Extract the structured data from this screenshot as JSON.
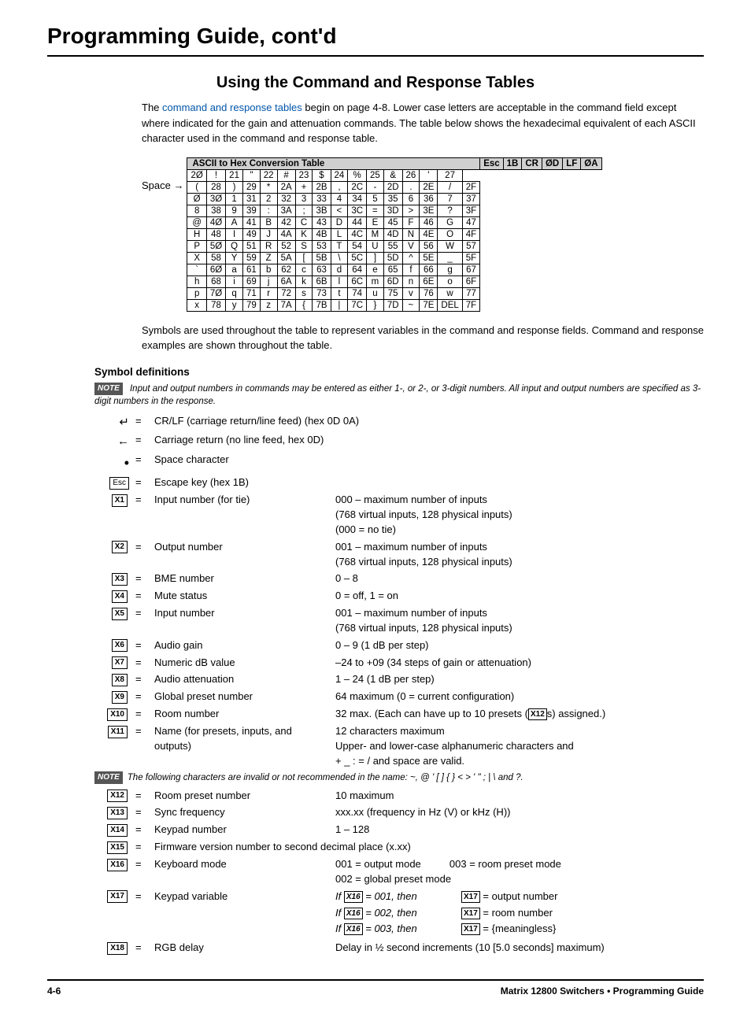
{
  "page": {
    "title": "Programming Guide, cont'd",
    "section_title": "Using the Command and Response Tables",
    "intro": {
      "text1": "The ",
      "link": "command and response tables",
      "text2": " begin on page 4-8.  Lower case letters are acceptable in the command field except where indicated for the gain and attenuation commands.  The table below shows the hexadecimal equivalent of each ASCII character used in the command and response table."
    },
    "table_caption": "ASCII to Hex  Conversion Table",
    "table_headers": [
      "Esc",
      "1B",
      "CR",
      "ØD",
      "LF",
      "ØA"
    ],
    "table_rows": [
      [
        "Space→",
        "2Ø",
        "!",
        "21",
        "\"",
        "22",
        "#",
        "23",
        "$",
        "24",
        "%",
        "25",
        "&",
        "26",
        "'",
        "27"
      ],
      [
        "(",
        "28",
        ")",
        "29",
        "*",
        "2A",
        "+",
        "2B",
        ",",
        "2C",
        "-",
        "2D",
        ".",
        "2E",
        "/",
        "2F"
      ],
      [
        "Ø",
        "3Ø",
        "1",
        "31",
        "2",
        "32",
        "3",
        "33",
        "4",
        "34",
        "5",
        "35",
        "6",
        "36",
        "7",
        "37"
      ],
      [
        "8",
        "38",
        "9",
        "39",
        ":",
        "3A",
        ";",
        "3B",
        "<",
        "3C",
        "=",
        "3D",
        ">",
        "3E",
        "?",
        "3F"
      ],
      [
        "@",
        "4Ø",
        "A",
        "41",
        "B",
        "42",
        "C",
        "43",
        "D",
        "44",
        "E",
        "45",
        "F",
        "46",
        "G",
        "47"
      ],
      [
        "H",
        "48",
        "I",
        "49",
        "J",
        "4A",
        "K",
        "4B",
        "L",
        "4C",
        "M",
        "4D",
        "N",
        "4E",
        "O",
        "4F"
      ],
      [
        "P",
        "5Ø",
        "Q",
        "51",
        "R",
        "52",
        "S",
        "53",
        "T",
        "54",
        "U",
        "55",
        "V",
        "56",
        "W",
        "57"
      ],
      [
        "X",
        "58",
        "Y",
        "59",
        "Z",
        "5A",
        "[",
        "5B",
        "\\",
        "5C",
        "]",
        "5D",
        "^",
        "5E",
        "_",
        "5F"
      ],
      [
        "`",
        "6Ø",
        "a",
        "61",
        "b",
        "62",
        "c",
        "63",
        "d",
        "64",
        "e",
        "65",
        "f",
        "66",
        "g",
        "67"
      ],
      [
        "h",
        "68",
        "i",
        "69",
        "j",
        "6A",
        "k",
        "6B",
        "l",
        "6C",
        "m",
        "6D",
        "n",
        "6E",
        "o",
        "6F"
      ],
      [
        "p",
        "7Ø",
        "q",
        "71",
        "r",
        "72",
        "s",
        "73",
        "t",
        "74",
        "u",
        "75",
        "v",
        "76",
        "w",
        "77"
      ],
      [
        "x",
        "78",
        "y",
        "79",
        "z",
        "7A",
        "{",
        "7B",
        "|",
        "7C",
        "}",
        "7D",
        "~",
        "7E",
        "DEL",
        "7F"
      ]
    ],
    "symbols_text": "Symbols are used throughout the table to represent variables in the command and response fields.  Command and response examples are shown throughout the table.",
    "symbol_defs_title": "Symbol definitions",
    "note1_text": "Input and output numbers in commands may be entered as either 1-, or 2-, or 3-digit numbers.  All input and output numbers are specified as 3-digit numbers in the response.",
    "definitions": [
      {
        "symbol": "↵",
        "equals": "=",
        "label": "CR/LF (carriage return/line feed) (hex 0D 0A)",
        "value": ""
      },
      {
        "symbol": "←",
        "equals": "=",
        "label": "Carriage return (no line feed, hex 0D)",
        "value": ""
      },
      {
        "symbol": "•",
        "equals": "=",
        "label": "Space character",
        "value": ""
      },
      {
        "symbol": "Esc",
        "equals": "=",
        "label": "Escape key (hex 1B)",
        "value": ""
      },
      {
        "symbol": "X1",
        "equals": "=",
        "label": "Input number (for tie)",
        "value": "000 – maximum number of inputs\n(768 virtual inputs, 128 physical inputs)\n(000 = no tie)"
      },
      {
        "symbol": "X2",
        "equals": "=",
        "label": "Output number",
        "value": "001 – maximum number of inputs\n(768 virtual inputs, 128 physical inputs)"
      },
      {
        "symbol": "X3",
        "equals": "=",
        "label": "BME number",
        "value": "0 – 8"
      },
      {
        "symbol": "X4",
        "equals": "=",
        "label": "Mute status",
        "value": "0 = off, 1 = on"
      },
      {
        "symbol": "X5",
        "equals": "=",
        "label": "Input number",
        "value": "001 – maximum number of inputs\n(768 virtual inputs, 128 physical inputs)"
      },
      {
        "symbol": "X6",
        "equals": "=",
        "label": "Audio gain",
        "value": "0 – 9 (1 dB per step)"
      },
      {
        "symbol": "X7",
        "equals": "=",
        "label": "Numeric dB value",
        "value": "–24 to +09 (34 steps of gain or attenuation)"
      },
      {
        "symbol": "X8",
        "equals": "=",
        "label": "Audio attenuation",
        "value": "1 – 24 (1 dB per step)"
      },
      {
        "symbol": "X9",
        "equals": "=",
        "label": "Global preset number",
        "value": "64 maximum (0 = current configuration)"
      },
      {
        "symbol": "X10",
        "equals": "=",
        "label": "Room number",
        "value": "32 max. (Each can have up to 10 presets (X12s) assigned.)"
      },
      {
        "symbol": "X11",
        "equals": "=",
        "label": "Name (for presets, inputs, and outputs)",
        "value": "12 characters maximum\nUpper- and lower-case alphanumeric characters and\n+ _ : = /  and space are valid."
      },
      {
        "symbol": "NOTE",
        "type": "note",
        "text": "The following characters are invalid or not recommended in the name: ~, @ ' [ ] { } < > ' \" ; |  \\ and ?."
      },
      {
        "symbol": "X12",
        "equals": "=",
        "label": "Room preset number",
        "value": "10 maximum"
      },
      {
        "symbol": "X13",
        "equals": "=",
        "label": "Sync frequency",
        "value": "xxx.xx (frequency in Hz (V) or kHz (H))"
      },
      {
        "symbol": "X14",
        "equals": "=",
        "label": "Keypad number",
        "value": "1 – 128"
      },
      {
        "symbol": "X15",
        "equals": "=",
        "label": "Firmware version number to second decimal place (x.xx)",
        "value": ""
      },
      {
        "symbol": "X16",
        "equals": "=",
        "label": "Keyboard mode",
        "value": "001 = output mode          003 = room preset mode\n002 = global preset mode"
      },
      {
        "symbol": "X17",
        "equals": "=",
        "label": "Keypad variable",
        "value": "if_x16_001",
        "type": "keypad_variable"
      },
      {
        "symbol": "X18",
        "equals": "=",
        "label": "RGB delay",
        "value": "Delay in ½ second increments (10 [5.0 seconds] maximum)"
      }
    ],
    "keypad_variable_rows": [
      {
        "condition": "If X16 = 001, then",
        "result": "X17 = output number"
      },
      {
        "condition": "If X16 = 002, then",
        "result": "X17 = room number"
      },
      {
        "condition": "If X16 = 003, then",
        "result": "X17 = {meaningless}"
      }
    ],
    "footer": {
      "left": "4-6",
      "right": "Matrix 12800 Switchers • Programming Guide"
    }
  }
}
